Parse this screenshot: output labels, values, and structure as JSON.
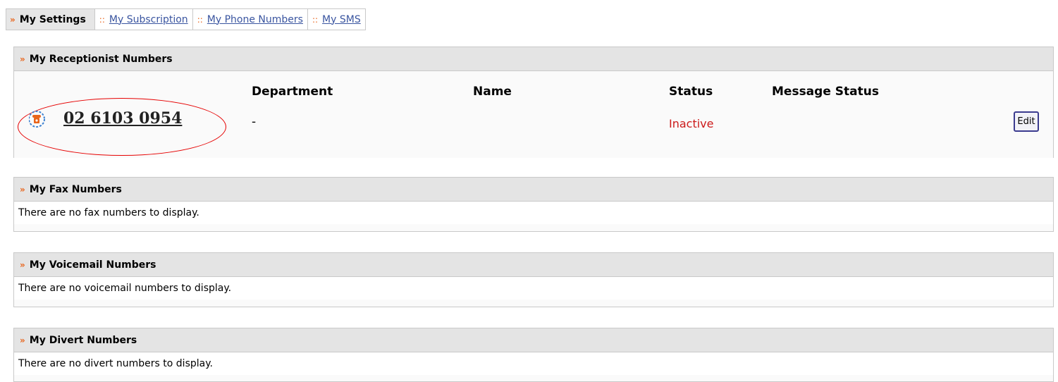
{
  "tabs": [
    {
      "label": "My Settings",
      "active": true,
      "marker": "»"
    },
    {
      "label": "My Subscription",
      "active": false,
      "marker": "::"
    },
    {
      "label": "My Phone Numbers",
      "active": false,
      "marker": "::"
    },
    {
      "label": "My SMS",
      "active": false,
      "marker": "::"
    }
  ],
  "receptionist": {
    "title": "My Receptionist Numbers",
    "columns": {
      "department": "Department",
      "name": "Name",
      "status": "Status",
      "message_status": "Message Status"
    },
    "row": {
      "number": "02 6103 0954",
      "department": "-",
      "name": "",
      "status": "Inactive",
      "message_status": "",
      "edit_label": "Edit"
    }
  },
  "fax": {
    "title": "My Fax Numbers",
    "empty_message": "There are no fax numbers to display."
  },
  "voicemail": {
    "title": "My Voicemail Numbers",
    "empty_message": "There are no voicemail numbers to display."
  },
  "divert": {
    "title": "My Divert Numbers",
    "empty_message": "There are no divert numbers to display."
  },
  "colors": {
    "accent_marker": "#e8641b",
    "link": "#3a55a0",
    "status_inactive": "#cc1a1a",
    "annotation_oval": "#e60000"
  },
  "icons": {
    "phone": "phone-icon"
  }
}
